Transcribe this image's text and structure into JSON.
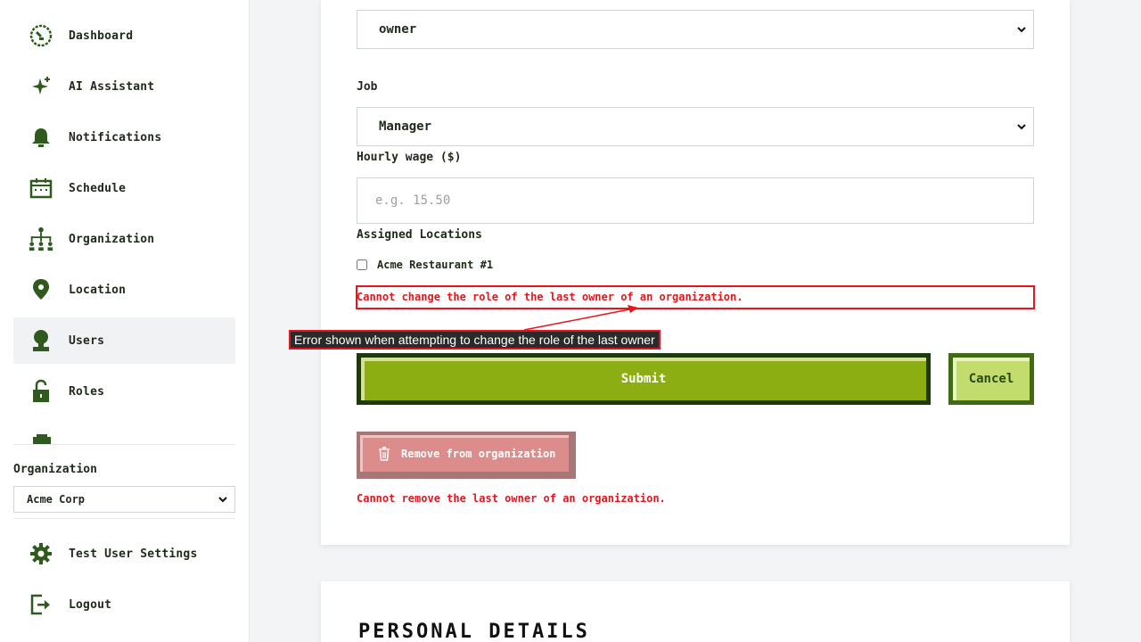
{
  "sidebar": {
    "items": [
      {
        "label": "Dashboard",
        "icon": "dashboard-icon"
      },
      {
        "label": "AI Assistant",
        "icon": "sparkle-icon"
      },
      {
        "label": "Notifications",
        "icon": "bell-icon"
      },
      {
        "label": "Schedule",
        "icon": "calendar-icon"
      },
      {
        "label": "Organization",
        "icon": "org-chart-icon"
      },
      {
        "label": "Location",
        "icon": "map-pin-icon"
      },
      {
        "label": "Users",
        "icon": "user-icon",
        "active": true
      },
      {
        "label": "Roles",
        "icon": "lock-icon"
      }
    ],
    "organization_label": "Organization",
    "organization_value": "Acme Corp",
    "bottom_items": [
      {
        "label": "Test User Settings",
        "icon": "gear-icon"
      },
      {
        "label": "Logout",
        "icon": "logout-icon"
      }
    ]
  },
  "form": {
    "role_value": "owner",
    "job_label": "Job",
    "job_value": "Manager",
    "wage_label": "Hourly wage ($)",
    "wage_placeholder": "e.g. 15.50",
    "locations_label": "Assigned Locations",
    "location_option": "Acme Restaurant #1",
    "role_error": "Cannot change the role of the last owner of an organization.",
    "submit_label": "Submit",
    "cancel_label": "Cancel",
    "remove_label": "Remove from organization",
    "remove_error": "Cannot remove the last owner of an organization."
  },
  "annotation": {
    "text": "Error shown when attempting to change the role of the last owner"
  },
  "personal_details": {
    "title": "PERSONAL DETAILS"
  },
  "colors": {
    "icon_green": "#2e5a1e",
    "error_red": "#e5141d",
    "submit_bg": "#8cae12",
    "submit_border": "#1e3a0c",
    "cancel_bg": "#c2dd6e",
    "remove_bg": "#dc8d8b"
  }
}
